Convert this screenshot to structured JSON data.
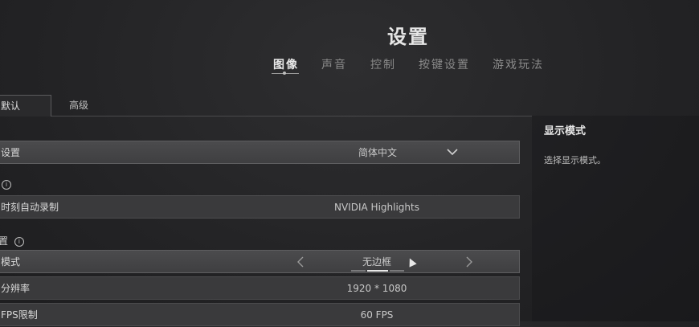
{
  "page_title": "设置",
  "tabs": [
    "图像",
    "声音",
    "控制",
    "按键设置",
    "游戏玩法"
  ],
  "subtabs": {
    "default": "默认",
    "advanced": "高级"
  },
  "rows": {
    "language": {
      "label": "设置",
      "value": "简体中文"
    },
    "highlights": {
      "label": "时刻自动录制",
      "value": "NVIDIA Highlights"
    },
    "display_mode": {
      "label": "模式",
      "value": "无边框"
    },
    "resolution": {
      "label": "分辨率",
      "value": "1920 * 1080"
    },
    "fps": {
      "label": "FPS限制",
      "value": "60 FPS"
    }
  },
  "section_display": "置",
  "info_icon": "i",
  "side_panel": {
    "heading": "显示模式",
    "description": "选择显示模式。"
  },
  "colors": {
    "background": "#232325",
    "row": "#3a3a3c",
    "highlight_row": "#4b4b4d",
    "accent_line": "#e8e8e8"
  }
}
